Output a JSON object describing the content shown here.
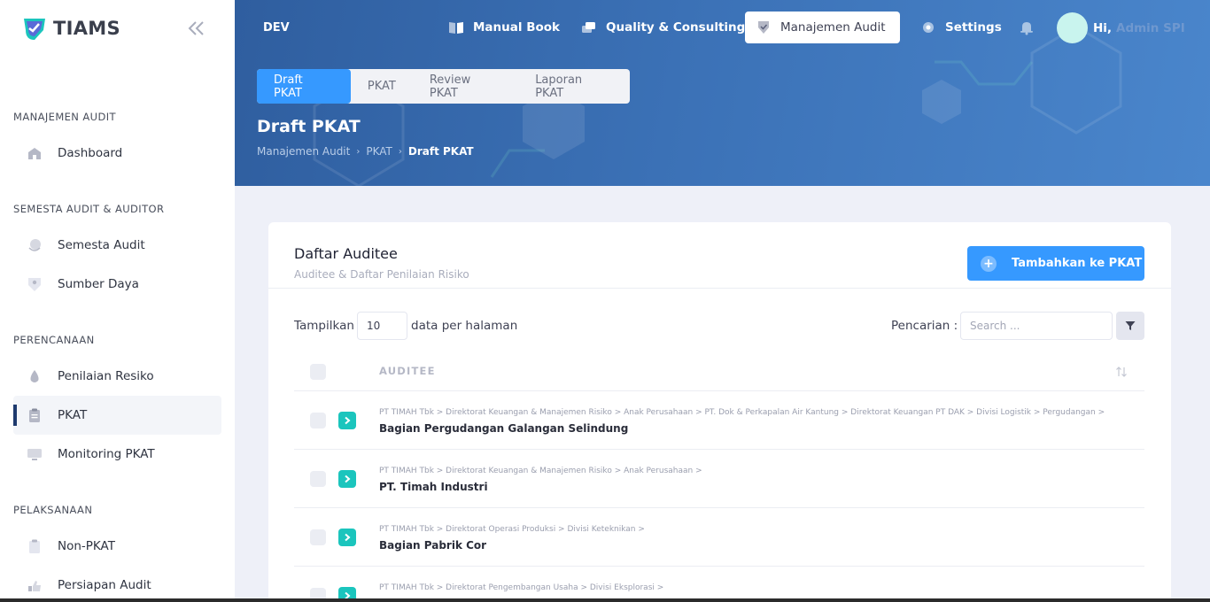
{
  "brand": {
    "name": "TIAMS"
  },
  "sidebar": {
    "sections": [
      {
        "title": "MANAJEMEN AUDIT"
      },
      {
        "title": "SEMESTA AUDIT & AUDITOR"
      },
      {
        "title": "PERENCANAAN"
      },
      {
        "title": "PELAKSANAAN"
      }
    ],
    "items": [
      {
        "label": "Dashboard",
        "icon": "home-icon"
      },
      {
        "label": "Semesta Audit",
        "icon": "globe-icon"
      },
      {
        "label": "Sumber Daya",
        "icon": "user-shield-icon"
      },
      {
        "label": "Penilaian Resiko",
        "icon": "drop-icon"
      },
      {
        "label": "PKAT",
        "icon": "clipboard-icon",
        "active": true
      },
      {
        "label": "Monitoring PKAT",
        "icon": "monitor-icon"
      },
      {
        "label": "Non-PKAT",
        "icon": "clipboard-icon"
      },
      {
        "label": "Persiapan Audit",
        "icon": "thumbs-up-icon"
      }
    ]
  },
  "header": {
    "env": "DEV",
    "nav": [
      {
        "label": "Manual Book",
        "icon": "book-icon"
      },
      {
        "label": "Quality & Consulting",
        "icon": "layers-icon"
      },
      {
        "label": "Manajemen Audit",
        "icon": "shield-icon",
        "active": true
      },
      {
        "label": "Settings",
        "icon": "gear-icon"
      }
    ],
    "greeting": "Hi,",
    "user_name": "Admin SPI"
  },
  "tabs": [
    {
      "label": "Draft PKAT",
      "active": true
    },
    {
      "label": "PKAT"
    },
    {
      "label": "Review PKAT"
    },
    {
      "label": "Laporan PKAT"
    }
  ],
  "page": {
    "title": "Draft PKAT",
    "breadcrumb": [
      "Manajemen Audit",
      "PKAT",
      "Draft PKAT"
    ]
  },
  "card": {
    "title": "Daftar Auditee",
    "subtitle": "Auditee & Daftar Penilaian Risiko",
    "add_button": "Tambahkan ke PKAT",
    "show_label": "Tampilkan",
    "page_size": "10",
    "show_suffix": "data per halaman",
    "search_label": "Pencarian :",
    "search_placeholder": "Search ...",
    "column_header": "AUDITEE",
    "rows": [
      {
        "path": "PT TIMAH Tbk  > Direktorat Keuangan & Manajemen Risiko  > Anak Perusahaan  > PT. Dok & Perkapalan Air Kantung  > Direktorat Keuangan PT DAK  > Divisi Logistik  > Pergudangan  >",
        "title": "Bagian Pergudangan Galangan Selindung"
      },
      {
        "path": "PT TIMAH Tbk  > Direktorat Keuangan & Manajemen Risiko  > Anak Perusahaan  >",
        "title": "PT. Timah Industri"
      },
      {
        "path": "PT TIMAH Tbk  > Direktorat Operasi Produksi  > Divisi Keteknikan  >",
        "title": "Bagian Pabrik Cor"
      },
      {
        "path": "PT TIMAH Tbk  > Direktorat Pengembangan Usaha  > Divisi Eksplorasi  >",
        "title": ""
      }
    ]
  },
  "colors": {
    "primary": "#3699ff",
    "teal": "#1bc5bd",
    "header": "#3b71b6"
  }
}
